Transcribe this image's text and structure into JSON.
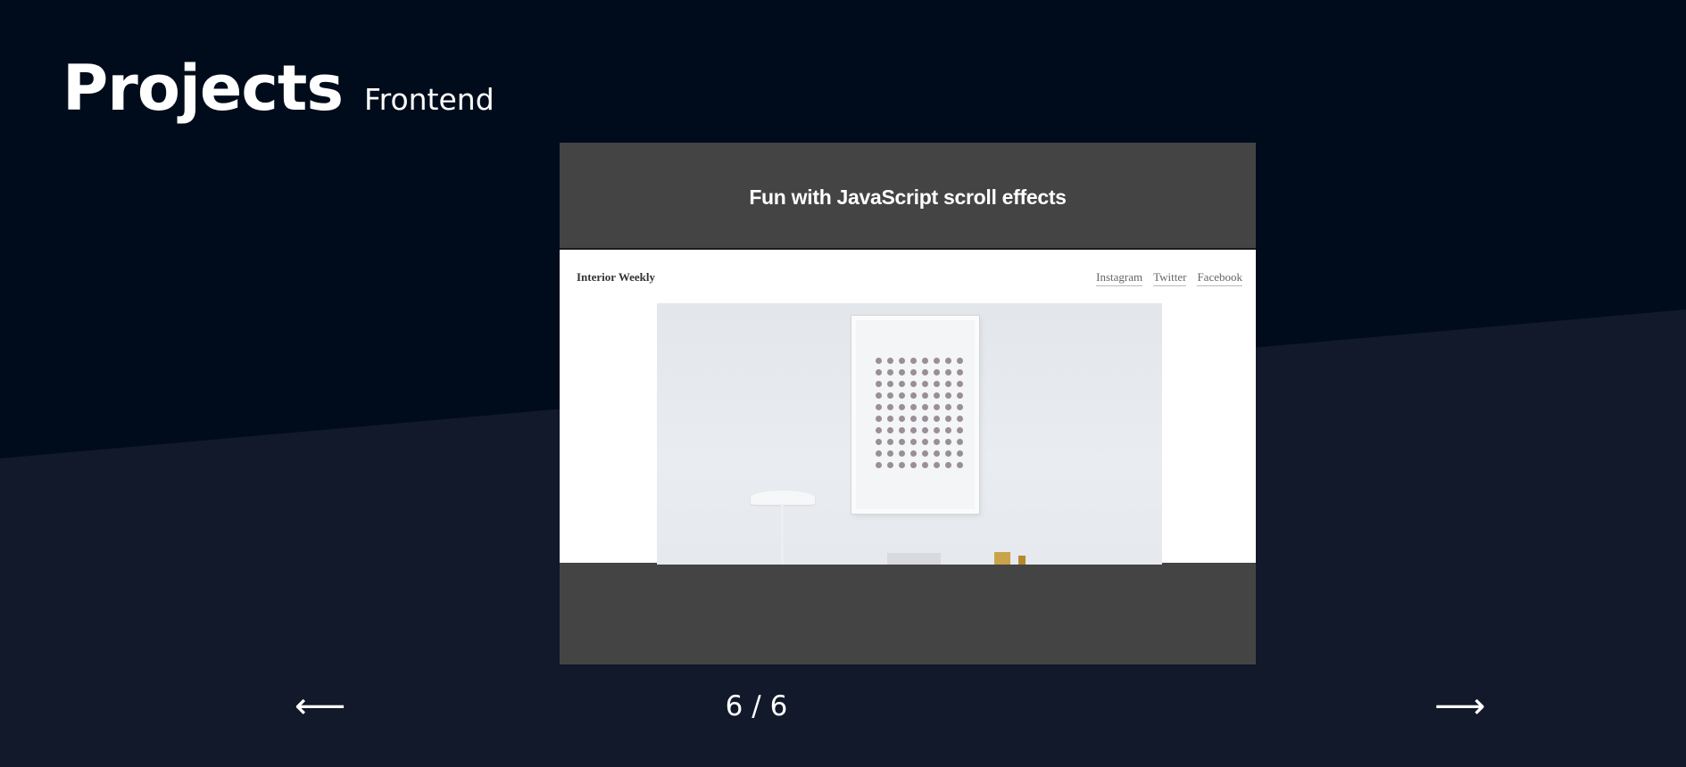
{
  "colors": {
    "background_top": "#000c1b",
    "background_bottom": "#11192a",
    "card_background": "#444444",
    "text": "#ffffff"
  },
  "header": {
    "title": "Projects",
    "subtitle": "Frontend"
  },
  "card": {
    "title": "Fun with JavaScript scroll effects",
    "preview": {
      "brand": "Interior Weekly",
      "nav": [
        "Instagram",
        "Twitter",
        "Facebook"
      ]
    }
  },
  "pager": {
    "prev_icon": "left-arrow-icon",
    "prev_glyph": "⟵",
    "next_icon": "right-arrow-icon",
    "next_glyph": "⟶",
    "current": "6",
    "separator": "/",
    "total": "6"
  }
}
